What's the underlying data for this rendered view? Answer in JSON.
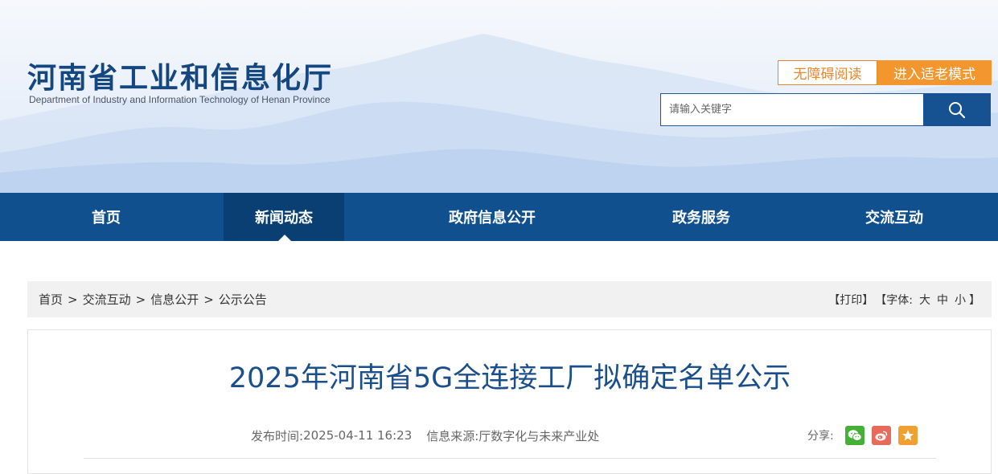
{
  "header": {
    "title": "河南省工业和信息化厅",
    "subtitle": "Department of Industry and Information Technology of Henan Province",
    "accessible_label": "无障碍阅读",
    "elder_label": "进入适老模式",
    "search_placeholder": "请输入关键字"
  },
  "nav": {
    "items": [
      "首页",
      "新闻动态",
      "政府信息公开",
      "政务服务",
      "交流互动"
    ],
    "active_index": 1
  },
  "breadcrumb": {
    "items": [
      "首页",
      "交流互动",
      "信息公开",
      "公示公告"
    ],
    "separator": ">"
  },
  "tools": {
    "print": "【打印】",
    "font_label": "【字体:",
    "size_large": "大",
    "size_medium": "中",
    "size_small": "小",
    "close": "】"
  },
  "article": {
    "title": "2025年河南省5G全连接工厂拟确定名单公示",
    "publish_label": "发布时间:",
    "publish_time": "2025-04-11 16:23",
    "source_label": "信息来源:",
    "source": "厅数字化与未来产业处",
    "share_label": "分享:"
  },
  "colors": {
    "brand_blue": "#10508f",
    "nav_active": "#0a3f73",
    "accent_orange": "#f3962d",
    "wechat_green": "#45b035",
    "weibo_red": "#e86a5a",
    "favorite_orange": "#f0a030"
  },
  "icons": [
    "search-icon",
    "wechat-icon",
    "weibo-icon",
    "star-icon"
  ]
}
